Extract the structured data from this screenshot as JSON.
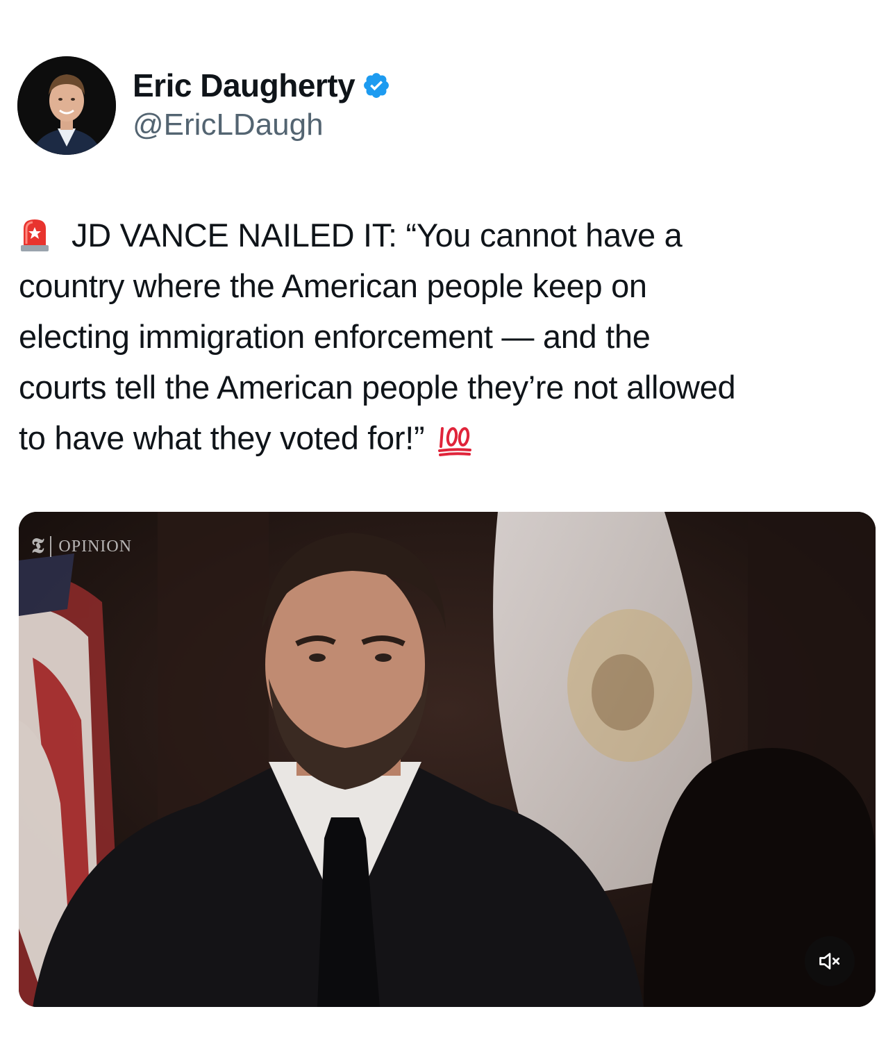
{
  "author": {
    "display_name": "Eric Daugherty",
    "handle": "@EricLDaugh",
    "verified": true,
    "verified_color": "#1d9bf0"
  },
  "tweet": {
    "leading_emoji": "police-car-light",
    "lines": [
      "JD VANCE NAILED IT: “You cannot have a",
      "country where the American people keep on",
      "electing immigration enforcement — and the",
      "courts tell the American people they’re not allowed",
      "to have what they voted for!”"
    ],
    "trailing_emoji": "hundred-points"
  },
  "media": {
    "type": "video",
    "watermark": {
      "logo": "𝕿",
      "label": "OPINION"
    },
    "mute_icon": "speaker-muted-icon"
  },
  "colors": {
    "text_primary": "#0f1419",
    "text_secondary": "#536471",
    "background": "#ffffff"
  }
}
